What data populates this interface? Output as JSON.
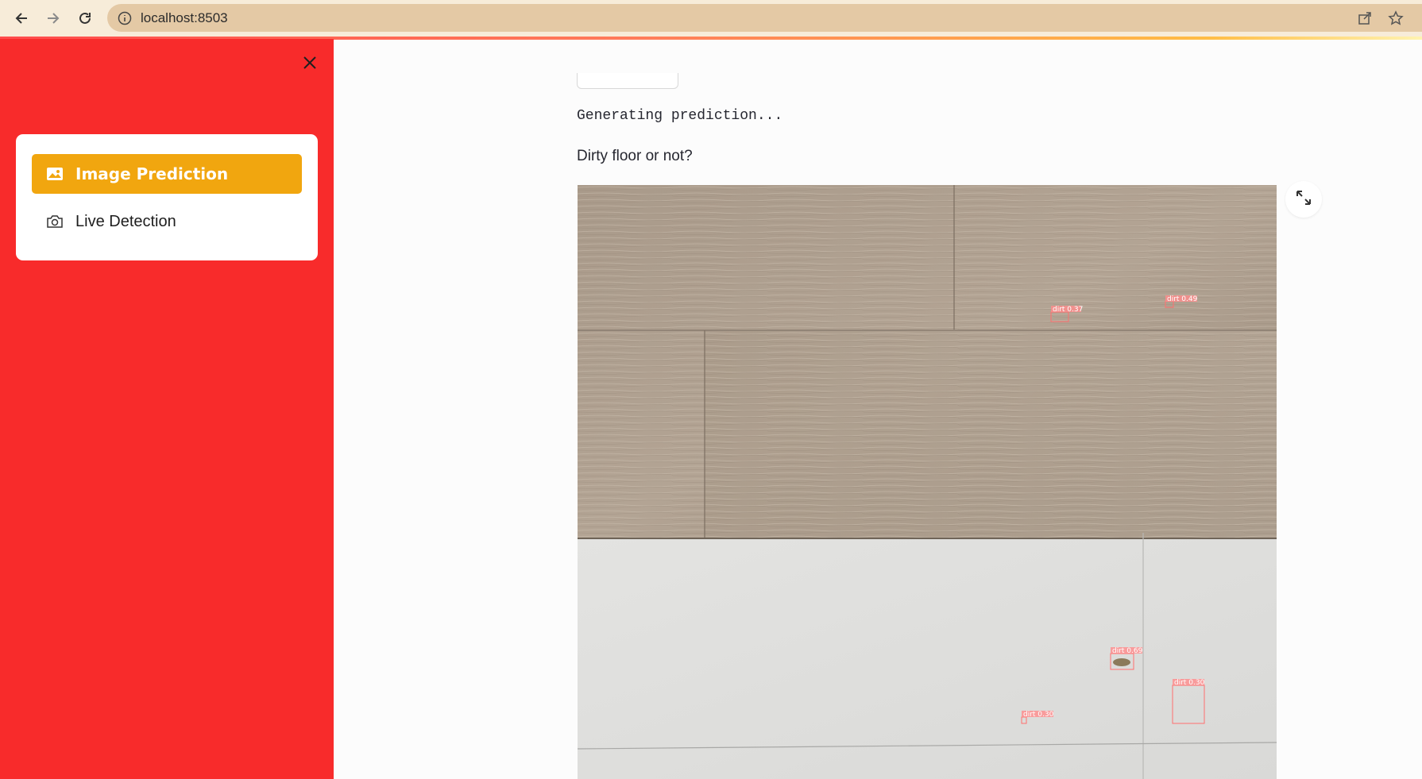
{
  "browser": {
    "url": "localhost:8503",
    "icons": [
      "back-arrow-icon",
      "forward-arrow-icon",
      "reload-icon",
      "site-info-icon",
      "share-icon",
      "bookmark-star-icon"
    ]
  },
  "sidebar": {
    "background": "#f82b2b",
    "menu": [
      {
        "label": "Image Prediction",
        "icon": "image-icon",
        "active": true
      },
      {
        "label": "Live Detection",
        "icon": "camera-icon",
        "active": false
      }
    ],
    "active_color": "#f1a60f"
  },
  "main": {
    "status": "Generating prediction...",
    "question": "Dirty floor or not?",
    "detections": [
      {
        "label": "dirt 0.37"
      },
      {
        "label": "dirt 0.49"
      },
      {
        "label": "dirt 0.69"
      },
      {
        "label": "dirt 0.30"
      },
      {
        "label": "dirt 0.30"
      }
    ],
    "box_color": "#ff6f6f"
  }
}
